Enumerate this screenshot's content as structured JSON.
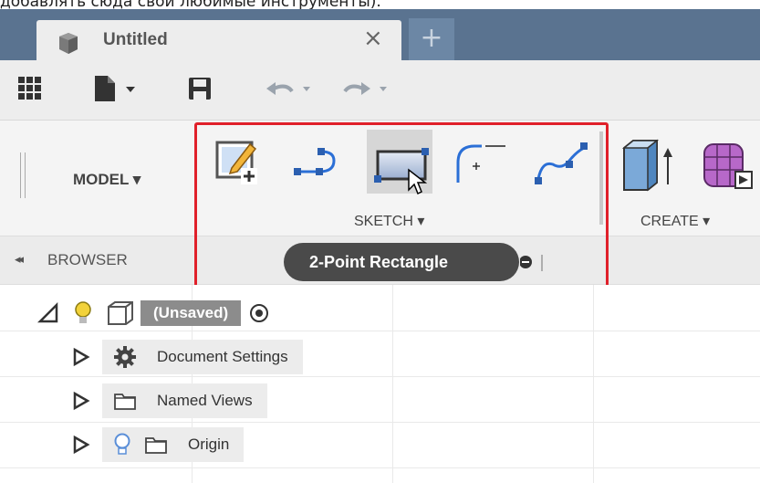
{
  "caption": "добавлять сюда свои любимые инструменты).",
  "tab": {
    "title": "Untitled",
    "close": "×",
    "add": "+"
  },
  "ribbon": {
    "workspace": "MODEL ▾",
    "sketch_group": "SKETCH ▾",
    "create_group": "CREATE ▾"
  },
  "tooltip": {
    "text": "2-Point Rectangle"
  },
  "browser": {
    "title": "BROWSER",
    "collapse": "◂◂",
    "root": "(Unsaved)",
    "items": [
      {
        "label": "Document Settings"
      },
      {
        "label": "Named Views"
      },
      {
        "label": "Origin"
      }
    ]
  },
  "colors": {
    "tabbar": "#5a7390",
    "highlight": "#e0202a",
    "accent_blue": "#2b6fd6",
    "tooltip_bg": "#4a4a4a"
  }
}
